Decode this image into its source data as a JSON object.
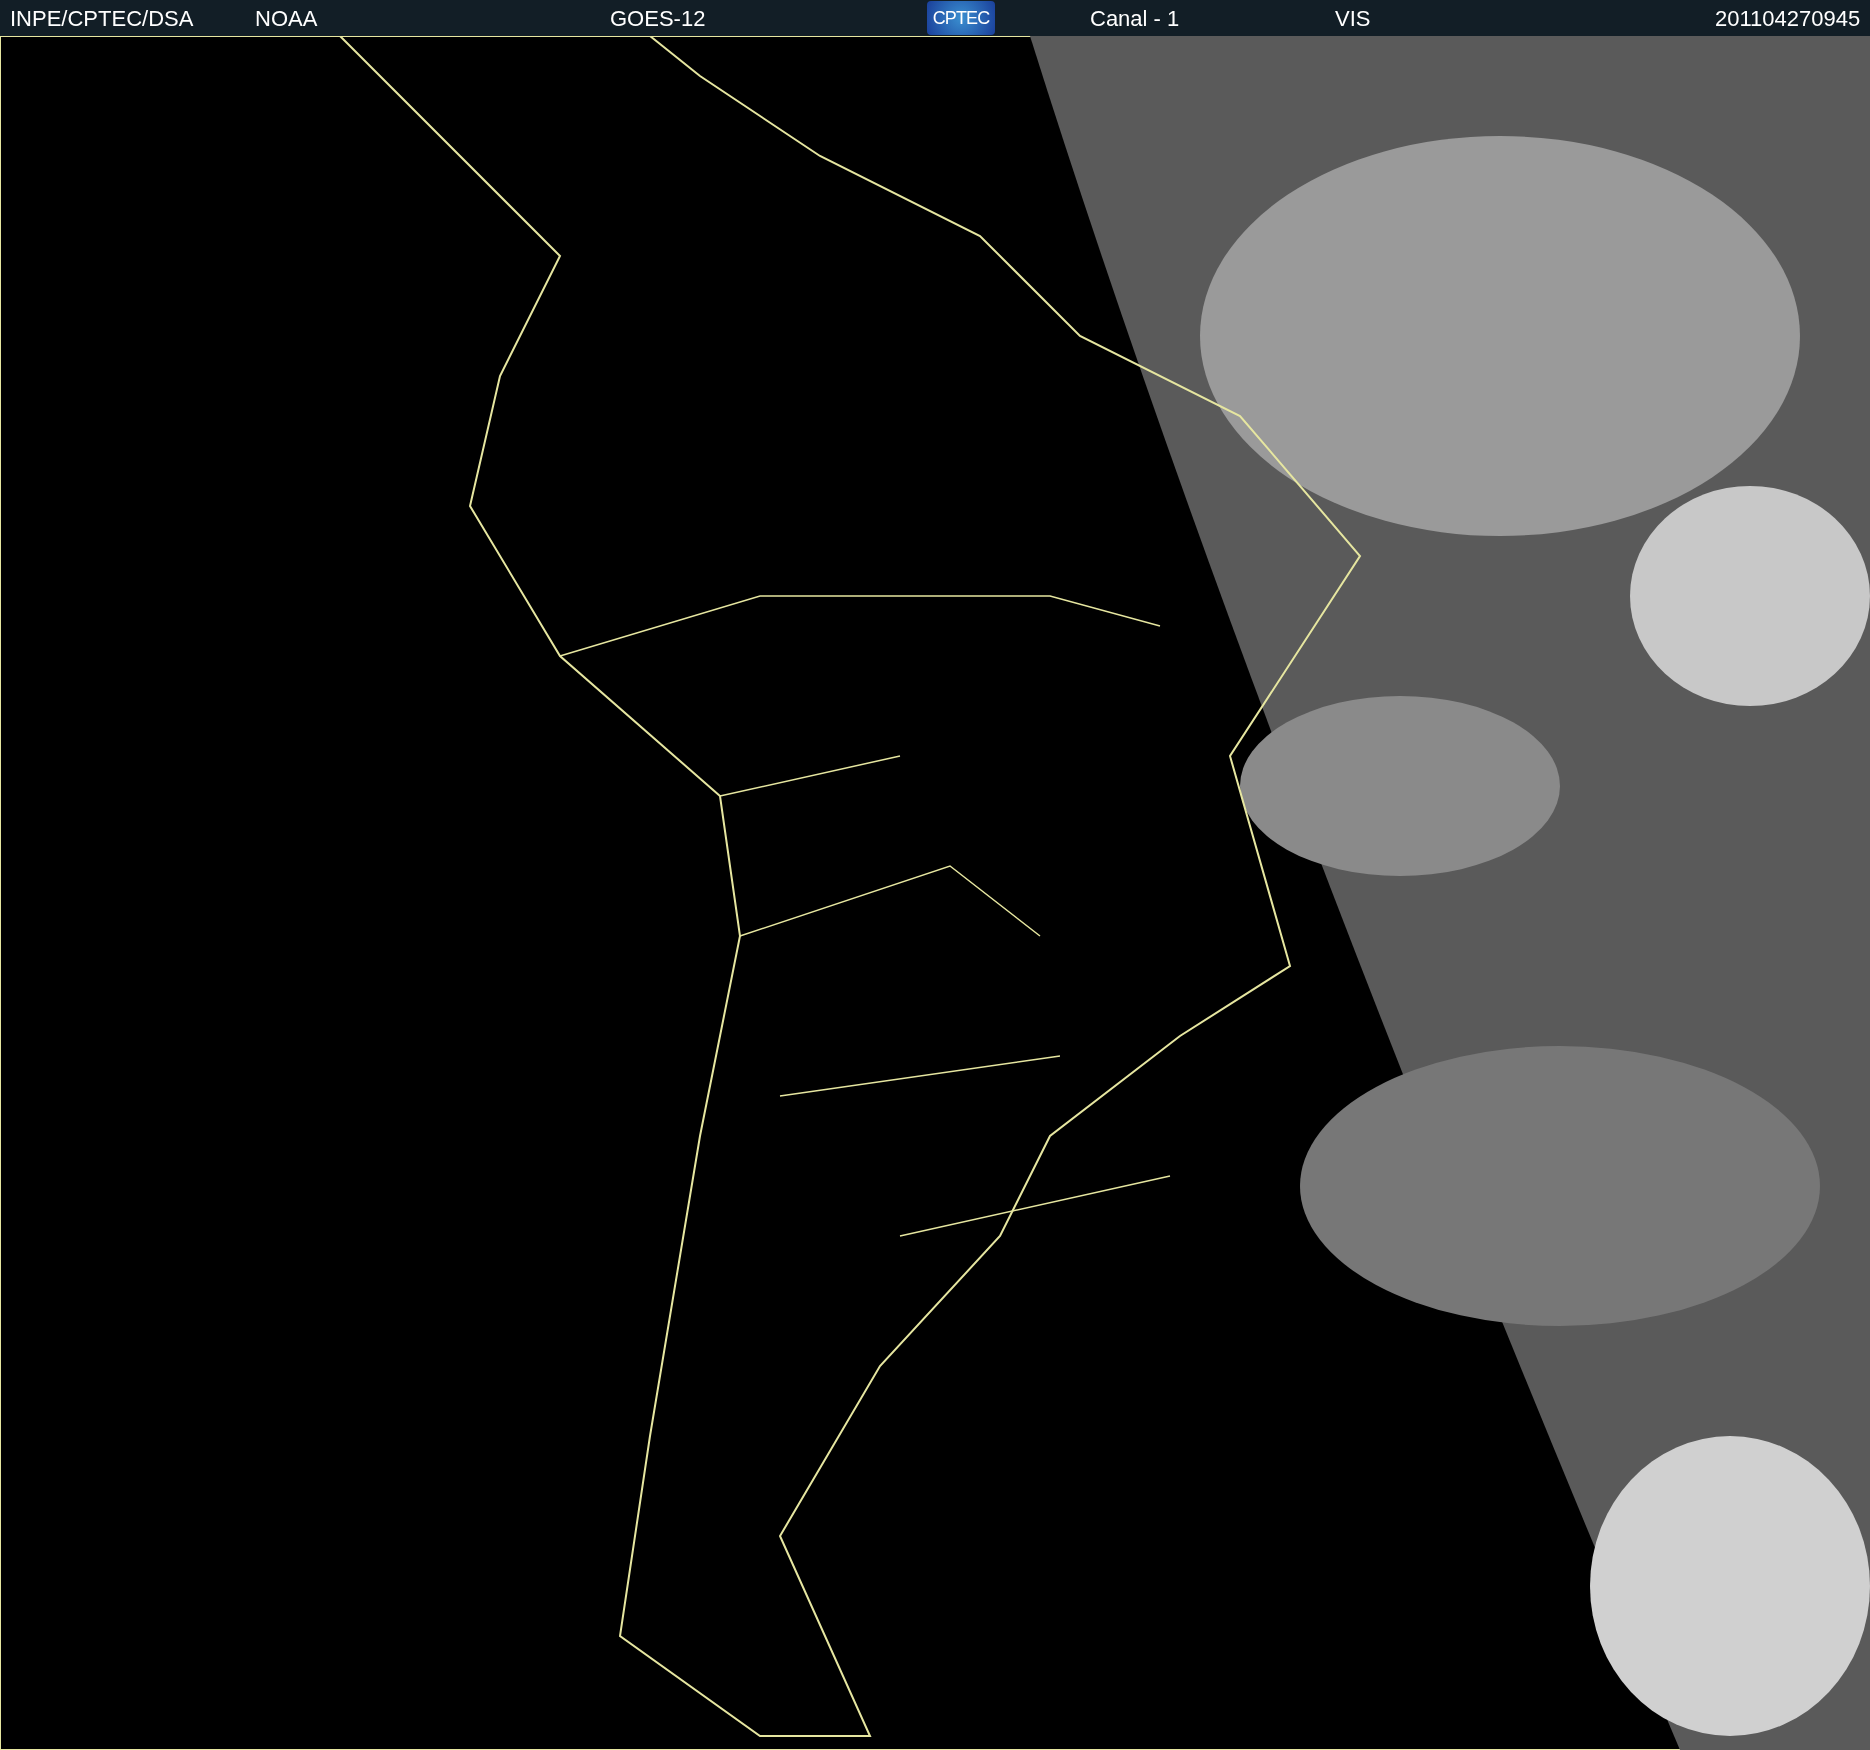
{
  "header": {
    "items": [
      "INPE/CPTEC/DSA",
      "NOAA",
      "GOES-12"
    ],
    "logo": "CPTEC",
    "items_right": [
      "Canal - 1",
      "VIS"
    ],
    "timestamp": "201104270945"
  }
}
